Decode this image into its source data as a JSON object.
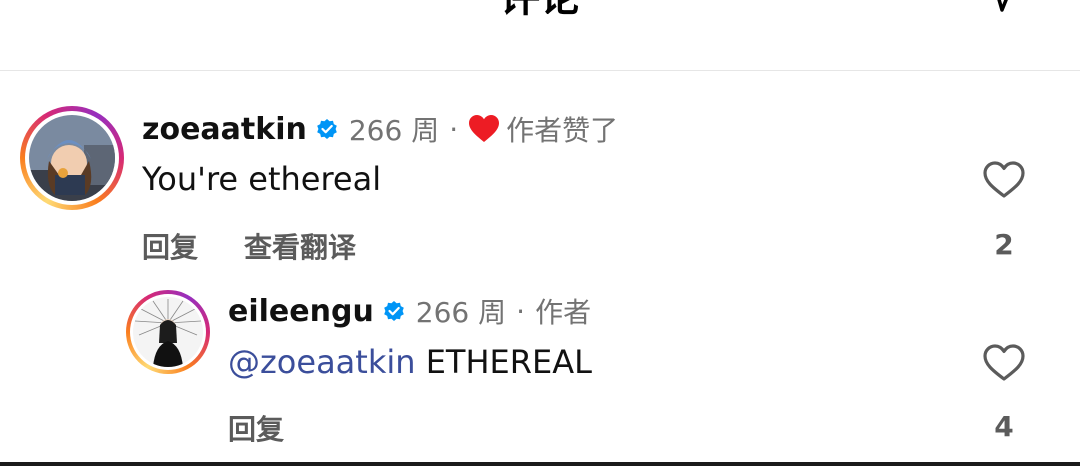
{
  "header": {
    "title": "评论",
    "icon": "share-icon"
  },
  "comments": [
    {
      "username": "zoeaatkin",
      "verified": true,
      "time": "266 周",
      "separator": "·",
      "liked_by_author_label": "作者赞了",
      "text": "You're ethereal",
      "actions": {
        "reply": "回复",
        "translate": "查看翻译"
      },
      "like_count": "2"
    }
  ],
  "replies": [
    {
      "username": "eileengu",
      "verified": true,
      "time": "266 周",
      "separator": "·",
      "author_label": "作者",
      "mention": "@zoeaatkin",
      "text": "ETHEREAL",
      "actions": {
        "reply": "回复"
      },
      "like_count": "4"
    }
  ],
  "colors": {
    "verified_blue": "#0095f6",
    "heart_red": "#ed1c24",
    "mention": "#3b4e9b",
    "muted": "#737373"
  }
}
